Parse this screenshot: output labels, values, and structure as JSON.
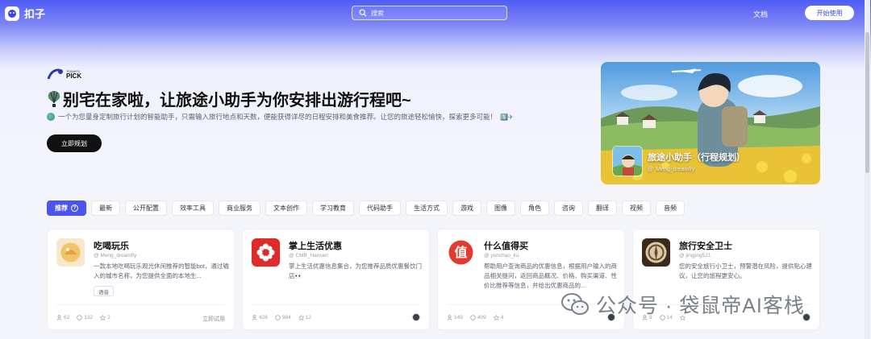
{
  "header": {
    "logo_text": "扣子",
    "search_placeholder": "搜索",
    "docs_label": "文档",
    "start_label": "开始使用"
  },
  "hero": {
    "badge_small": "TODAY'S",
    "badge_big": "PICK",
    "title": "别宅在家啦，让旅途小助手为你安排出游行程吧~",
    "description": "一个为您量身定制旅行计划的智能助手，只需输入旅行地点和天数，便能获得详尽的日程安排和美食推荐。让您的旅途轻松愉快，探索更多可能！",
    "description_emoji": "1️⃣✈",
    "cta_label": "立即规划",
    "feature": {
      "title": "旅途小助手（行程规划）",
      "author": "Meng_dreamfly"
    }
  },
  "tabs": [
    {
      "label": "推荐",
      "active": true
    },
    {
      "label": "最新"
    },
    {
      "label": "公开配置"
    },
    {
      "label": "效率工具"
    },
    {
      "label": "商业服务"
    },
    {
      "label": "文本创作"
    },
    {
      "label": "学习教育"
    },
    {
      "label": "代码助手"
    },
    {
      "label": "生活方式"
    },
    {
      "label": "游戏"
    },
    {
      "label": "图像"
    },
    {
      "label": "角色"
    },
    {
      "label": "咨询"
    },
    {
      "label": "翻译"
    },
    {
      "label": "视频"
    },
    {
      "label": "音频"
    }
  ],
  "cards": [
    {
      "title": "吃喝玩乐",
      "author": "Meng_dreamfly",
      "description": "一款本地吃喝玩乐观光休闲推荐的智能bot，通过输入的城市名称，为您提供全面的本地生...",
      "tag": "语音",
      "users": "62",
      "chats": "132",
      "stars": "2",
      "try_label": "立即试用",
      "accent": "#f3c36a"
    },
    {
      "title": "掌上生活优惠",
      "author": "CMB_Hansen",
      "description": "掌上生活优惠信息集合，为您推荐品质优惠餐饮门店👀",
      "users": "426",
      "chats": "984",
      "stars": "12",
      "accent": "#e02a2a"
    },
    {
      "title": "什么值得买",
      "author": "yunchao_liu",
      "description": "帮助用户查询商品的优惠信息，根据用户输入的商品相关提问，返回商品概况、价格、购买渠道、性价比推荐等信息，并给出优惠商品的...",
      "users": "149",
      "chats": "409",
      "stars": "4",
      "accent": "#e33a2e"
    },
    {
      "title": "旅行安全卫士",
      "author": "jingjing521",
      "description": "您的安全旅行小卫士，预警潜在风险，提供贴心建议，让您的旅程更安心。",
      "users": "9",
      "chats": "14",
      "stars": "",
      "accent": "#6b4a2a"
    }
  ],
  "watermark": "公众号 · 袋鼠帝AI客栈"
}
